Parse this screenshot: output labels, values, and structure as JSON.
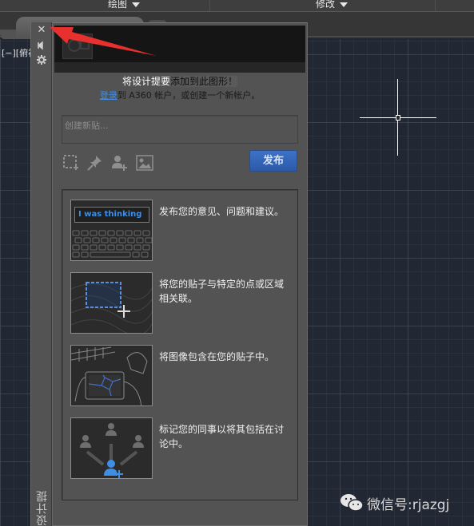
{
  "ribbon": {
    "groups": [
      {
        "label": "绘图"
      },
      {
        "label": "修改"
      }
    ]
  },
  "viewport": {
    "label": "[−][俯视"
  },
  "palette": {
    "side_title": "设计提要",
    "side_icons": [
      "close-icon",
      "auto-hide-icon",
      "settings-icon"
    ],
    "intro_line1_part1": "将设计提要",
    "intro_line1_part2": "添加到此图形！",
    "intro_line2_link": "登录",
    "intro_line2_rest": "到 A360 帐户，或创建一个新帐户。",
    "post_placeholder": "创建新贴...",
    "post_value": "",
    "tools": [
      {
        "name": "select-area-icon"
      },
      {
        "name": "pin-icon"
      },
      {
        "name": "add-user-icon"
      },
      {
        "name": "image-icon"
      }
    ],
    "publish_label": "发布",
    "features": [
      {
        "text": "发布您的意见、问题和建议。",
        "image_text": "I was thinking"
      },
      {
        "text": "将您的贴子与特定的点或区域相关联。"
      },
      {
        "text": "将图像包含在您的贴子中。"
      },
      {
        "text": "标记您的同事以将其包括在讨论中。"
      }
    ]
  },
  "watermark": {
    "text": "微信号:rjazgj"
  },
  "colors": {
    "accent_blue": "#3f8ee6",
    "publish_button": "#3565b8",
    "annotation_arrow": "#e8302e",
    "canvas_bg": "#222833",
    "panel_bg": "#535353"
  }
}
